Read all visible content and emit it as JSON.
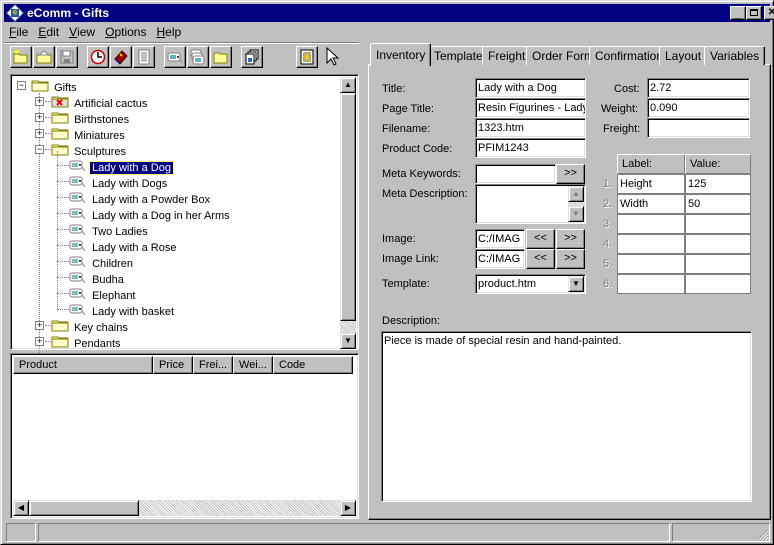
{
  "window": {
    "title": "eComm - Gifts",
    "controls": {
      "minimize": "_",
      "maximize": "□",
      "close": "✕"
    }
  },
  "menu": [
    {
      "label": "File",
      "accel": "F",
      "rest": "ile"
    },
    {
      "label": "Edit",
      "accel": "E",
      "rest": "dit"
    },
    {
      "label": "View",
      "accel": "V",
      "rest": "iew"
    },
    {
      "label": "Options",
      "accel": "O",
      "rest": "ptions"
    },
    {
      "label": "Help",
      "accel": "H",
      "rest": "elp"
    }
  ],
  "toolbar": [
    {
      "icon": "new-folder-icon"
    },
    {
      "icon": "open-folder-icon"
    },
    {
      "icon": "save-icon"
    },
    {
      "icon": "clock-icon"
    },
    {
      "icon": "book-icon"
    },
    {
      "icon": "document-icon"
    },
    {
      "icon": "product-tag-icon"
    },
    {
      "icon": "multiple-tags-icon"
    },
    {
      "icon": "folder-icon"
    },
    {
      "icon": "copy-pages-icon"
    },
    {
      "icon": "image-icon"
    },
    {
      "icon": "pointer-icon"
    }
  ],
  "tree": {
    "root": "Gifts",
    "categories": [
      {
        "label": "Artificial cactus",
        "state": "collapsed",
        "icon": "folder-error"
      },
      {
        "label": "Birthstones",
        "state": "collapsed"
      },
      {
        "label": "Miniatures",
        "state": "collapsed"
      },
      {
        "label": "Sculptures",
        "state": "expanded",
        "children": [
          "Lady with a Dog",
          "Lady with Dogs",
          "Lady with a Powder Box",
          "Lady with a Dog in her Arms",
          "Two Ladies",
          "Lady with a Rose",
          "Children",
          "Budha",
          "Elephant",
          "Lady with basket"
        ]
      },
      {
        "label": "Key chains",
        "state": "collapsed"
      },
      {
        "label": "Pendants",
        "state": "collapsed"
      }
    ],
    "selected": "Lady with a Dog"
  },
  "product_list": {
    "columns": [
      "Product",
      "Price",
      "Frei...",
      "Wei...",
      "Code"
    ],
    "rows": []
  },
  "tabs": [
    "Inventory",
    "Template",
    "Freight",
    "Order Form",
    "Confirmation",
    "Layout",
    "Variables"
  ],
  "active_tab": "Inventory",
  "inventory": {
    "title_label": "Title:",
    "title_value": "Lady with a Dog",
    "page_title_label": "Page Title:",
    "page_title_value": "Resin Figurines - Lady",
    "filename_label": "Filename:",
    "filename_value": "1323.htm",
    "product_code_label": "Product Code:",
    "product_code_value": "PFIM1243",
    "meta_keywords_label": "Meta Keywords:",
    "meta_keywords_value": "",
    "meta_keywords_btn": ">>",
    "meta_description_label": "Meta Description:",
    "meta_description_value": "",
    "image_label": "Image:",
    "image_value": "C:/IMAG",
    "image_link_label": "Image Link:",
    "image_link_value": "C:/IMAG",
    "prev_btn": "<<",
    "next_btn": ">>",
    "template_label": "Template:",
    "template_value": "product.htm",
    "cost_label": "Cost:",
    "cost_value": "2.72",
    "weight_label": "Weight:",
    "weight_value": "0.090",
    "freight_label": "Freight:",
    "freight_value": "",
    "attributes": {
      "label_header": "Label:",
      "value_header": "Value:",
      "rows": [
        {
          "num": "1.",
          "label": "Height",
          "value": "125"
        },
        {
          "num": "2.",
          "label": "Width",
          "value": "50"
        },
        {
          "num": "3.",
          "label": "",
          "value": ""
        },
        {
          "num": "4.",
          "label": "",
          "value": ""
        },
        {
          "num": "5.",
          "label": "",
          "value": ""
        },
        {
          "num": "6.",
          "label": "",
          "value": ""
        }
      ]
    },
    "description_label": "Description:",
    "description_value": "Piece is made of special resin and hand-painted."
  },
  "status": {
    "pane1": "",
    "pane2": ""
  }
}
